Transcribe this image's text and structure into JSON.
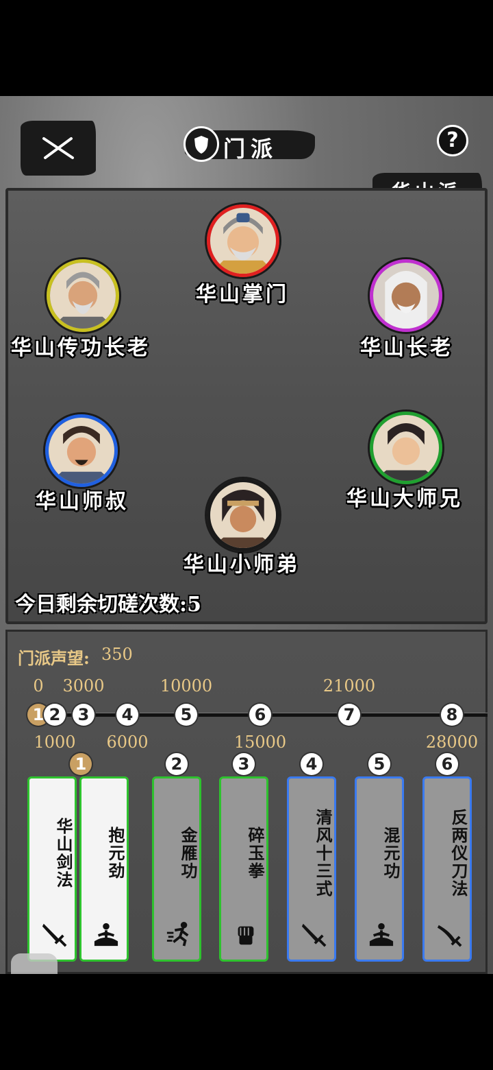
{
  "header": {
    "title": "门派",
    "sect_name": "华山派",
    "help_label": "?"
  },
  "members": [
    {
      "name": "华山掌门",
      "ring_color": "#e02020"
    },
    {
      "name": "华山传功长老",
      "ring_color": "#c8c020"
    },
    {
      "name": "华山长老",
      "ring_color": "#c030d0"
    },
    {
      "name": "华山师叔",
      "ring_color": "#2060e0"
    },
    {
      "name": "华山大师兄",
      "ring_color": "#20a030"
    },
    {
      "name": "华山小师弟",
      "ring_color": "#1a1a1a"
    }
  ],
  "remaining_text": "今日剩余切磋次数:5",
  "reputation": {
    "label": "门派声望:",
    "value": "350",
    "thresholds_top": [
      "0",
      "3000",
      "10000",
      "21000"
    ],
    "thresholds_bottom": [
      "1000",
      "6000",
      "15000",
      "28000"
    ],
    "nodes": [
      "1",
      "2",
      "3",
      "4",
      "5",
      "6",
      "7",
      "8"
    ],
    "progress": 0.0
  },
  "skills": [
    {
      "num": "1",
      "name": "华山剑法",
      "icon": "sword-icon",
      "border": "green",
      "unlocked": true
    },
    {
      "num": "1",
      "name": "抱元劲",
      "icon": "meditate-icon",
      "border": "green",
      "unlocked": true
    },
    {
      "num": "2",
      "name": "金雁功",
      "icon": "run-icon",
      "border": "green",
      "unlocked": false
    },
    {
      "num": "3",
      "name": "碎玉拳",
      "icon": "fist-icon",
      "border": "green",
      "unlocked": false
    },
    {
      "num": "4",
      "name": "清风十三式",
      "icon": "sword-icon",
      "border": "blue",
      "unlocked": false
    },
    {
      "num": "5",
      "name": "混元功",
      "icon": "meditate-icon",
      "border": "blue",
      "unlocked": false
    },
    {
      "num": "6",
      "name": "反两仪刀法",
      "icon": "saber-icon",
      "border": "blue",
      "unlocked": false
    }
  ]
}
